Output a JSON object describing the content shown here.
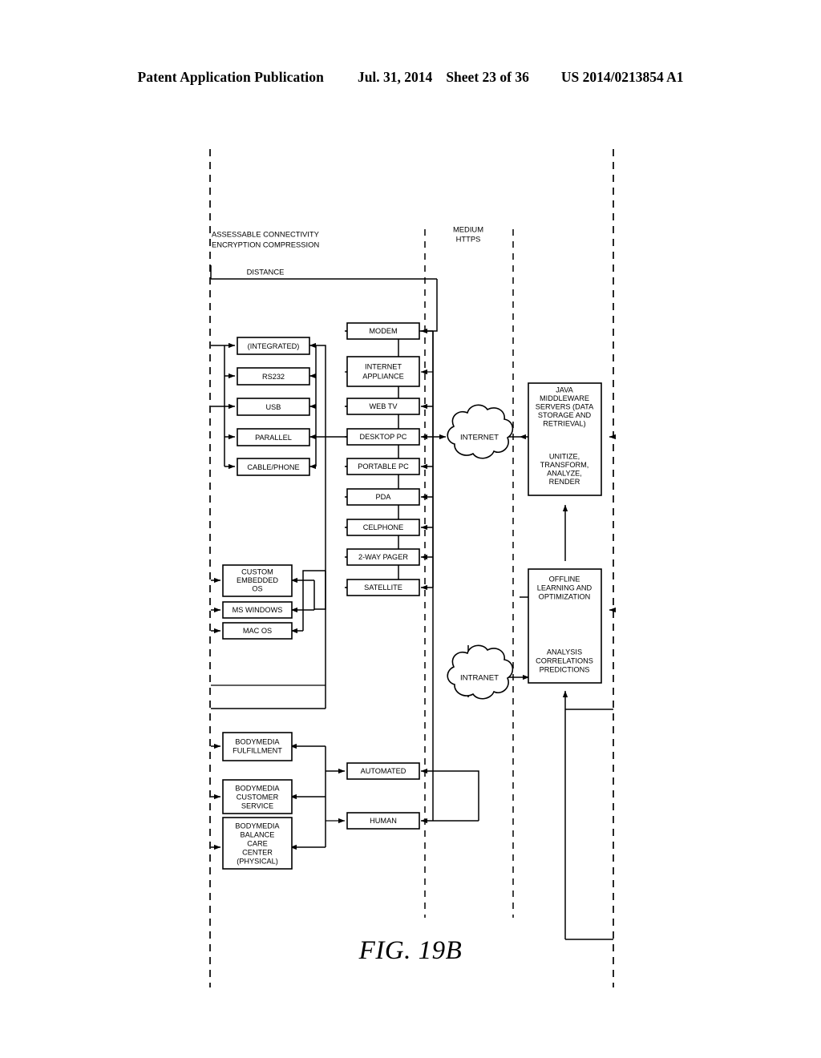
{
  "header": {
    "publication": "Patent Application Publication",
    "date": "Jul. 31, 2014",
    "sheet": "Sheet 23 of 36",
    "patent_number": "US 2014/0213854 A1"
  },
  "figure": {
    "caption": "FIG. 19B",
    "annotations": {
      "assessable_line1": "ASSESSABLE CONNECTIVITY",
      "assessable_line2": "ENCRYPTION COMPRESSION",
      "distance": "DISTANCE",
      "medium_line1": "MEDIUM",
      "medium_line2": "HTTPS"
    },
    "connectivity_boxes": [
      {
        "id": "integrated",
        "label": "(INTEGRATED)"
      },
      {
        "id": "rs232",
        "label": "RS232"
      },
      {
        "id": "usb",
        "label": "USB"
      },
      {
        "id": "parallel",
        "label": "PARALLEL"
      },
      {
        "id": "cable-phone",
        "label": "CABLE/PHONE"
      }
    ],
    "os_boxes": [
      {
        "id": "custom-embedded-os",
        "lines": [
          "CUSTOM",
          "EMBEDDED",
          "OS"
        ]
      },
      {
        "id": "ms-windows",
        "lines": [
          "MS WINDOWS"
        ]
      },
      {
        "id": "mac-os",
        "lines": [
          "MAC OS"
        ]
      }
    ],
    "device_boxes": [
      {
        "id": "modem",
        "lines": [
          "MODEM"
        ]
      },
      {
        "id": "internet-appliance",
        "lines": [
          "INTERNET",
          "APPLIANCE"
        ]
      },
      {
        "id": "web-tv",
        "lines": [
          "WEB TV"
        ]
      },
      {
        "id": "desktop-pc",
        "lines": [
          "DESKTOP PC"
        ]
      },
      {
        "id": "portable-pc",
        "lines": [
          "PORTABLE PC"
        ]
      },
      {
        "id": "pda",
        "lines": [
          "PDA"
        ]
      },
      {
        "id": "celphone",
        "lines": [
          "CELPHONE"
        ]
      },
      {
        "id": "two-way-pager",
        "lines": [
          "2-WAY PAGER"
        ]
      },
      {
        "id": "satellite",
        "lines": [
          "SATELLITE"
        ]
      }
    ],
    "clouds": [
      {
        "id": "internet",
        "label": "INTERNET"
      },
      {
        "id": "intranet",
        "label": "INTRANET"
      }
    ],
    "server_boxes": [
      {
        "id": "java-middleware",
        "top_lines": [
          "JAVA",
          "MIDDLEWARE",
          "SERVERS (DATA",
          "STORAGE AND",
          "RETRIEVAL)"
        ],
        "bottom_lines": [
          "UNITIZE,",
          "TRANSFORM,",
          "ANALYZE,",
          "RENDER"
        ]
      },
      {
        "id": "offline-learning",
        "top_lines": [
          "OFFLINE",
          "LEARNING AND",
          "OPTIMIZATION"
        ],
        "bottom_lines": [
          "ANALYSIS",
          "CORRELATIONS",
          "PREDICTIONS"
        ]
      }
    ],
    "service_boxes": [
      {
        "id": "bodymedia-fulfillment",
        "lines": [
          "BODYMEDIA",
          "FULFILLMENT"
        ]
      },
      {
        "id": "bodymedia-customer-service",
        "lines": [
          "BODYMEDIA",
          "CUSTOMER",
          "SERVICE"
        ]
      },
      {
        "id": "bodymedia-balance-care",
        "lines": [
          "BODYMEDIA",
          "BALANCE",
          "CARE",
          "CENTER",
          "(PHYSICAL)"
        ]
      }
    ],
    "channel_boxes": [
      {
        "id": "automated",
        "label": "AUTOMATED"
      },
      {
        "id": "human",
        "label": "HUMAN"
      }
    ]
  }
}
